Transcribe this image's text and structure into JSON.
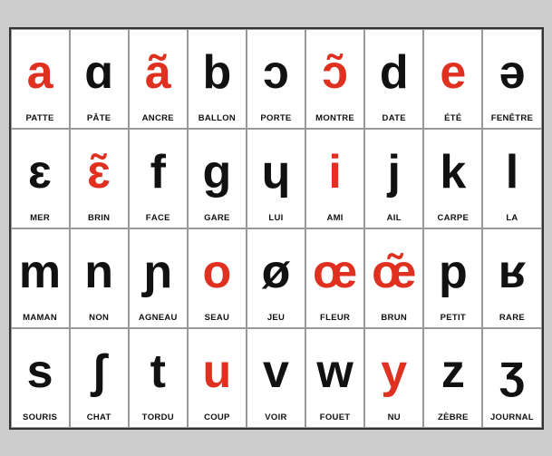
{
  "cells": [
    {
      "symbol": "a",
      "color": "red",
      "label": "PATTE",
      "boldChar": ""
    },
    {
      "symbol": "ɑ",
      "color": "black",
      "label": "PÂTE",
      "boldChar": ""
    },
    {
      "symbol": "ã",
      "color": "red",
      "label": "ANCRE",
      "boldChar": "AN"
    },
    {
      "symbol": "b",
      "color": "black",
      "label": "BALLON",
      "boldChar": "B"
    },
    {
      "symbol": "ɔ",
      "color": "black",
      "label": "PORTE",
      "boldChar": ""
    },
    {
      "symbol": "ɔ̃",
      "color": "red",
      "label": "MONTRE",
      "boldChar": "MON"
    },
    {
      "symbol": "d",
      "color": "black",
      "label": "DATE",
      "boldChar": "D"
    },
    {
      "symbol": "e",
      "color": "red",
      "label": "ÉTÉ",
      "boldChar": ""
    },
    {
      "symbol": "ə",
      "color": "black",
      "label": "FENÊTRE",
      "boldChar": ""
    },
    {
      "symbol": "ɛ",
      "color": "black",
      "label": "MER",
      "boldChar": ""
    },
    {
      "symbol": "ɛ̃",
      "color": "red",
      "label": "BRIN",
      "boldChar": "BRIN"
    },
    {
      "symbol": "f",
      "color": "black",
      "label": "FACE",
      "boldChar": "F"
    },
    {
      "symbol": "ɡ",
      "color": "black",
      "label": "GARE",
      "boldChar": "G"
    },
    {
      "symbol": "ɥ",
      "color": "black",
      "label": "LUI",
      "boldChar": ""
    },
    {
      "symbol": "i",
      "color": "red",
      "label": "AMI",
      "boldChar": ""
    },
    {
      "symbol": "j",
      "color": "black",
      "label": "AIL",
      "boldChar": ""
    },
    {
      "symbol": "k",
      "color": "black",
      "label": "CARPE",
      "boldChar": "C"
    },
    {
      "symbol": "l",
      "color": "black",
      "label": "LA",
      "boldChar": "L"
    },
    {
      "symbol": "m",
      "color": "black",
      "label": "MAMAN",
      "boldChar": "M"
    },
    {
      "symbol": "n",
      "color": "black",
      "label": "NON",
      "boldChar": "N"
    },
    {
      "symbol": "ɲ",
      "color": "black",
      "label": "AGNEAU",
      "boldChar": "GN"
    },
    {
      "symbol": "o",
      "color": "red",
      "label": "SEAU",
      "boldChar": ""
    },
    {
      "symbol": "ø",
      "color": "black",
      "label": "JEU",
      "boldChar": ""
    },
    {
      "symbol": "œ",
      "color": "red",
      "label": "FLEUR",
      "boldChar": ""
    },
    {
      "symbol": "œ̃",
      "color": "red",
      "label": "BRUN",
      "boldChar": "BRUN"
    },
    {
      "symbol": "p",
      "color": "black",
      "label": "PETIT",
      "boldChar": "P"
    },
    {
      "symbol": "ʁ",
      "color": "black",
      "label": "RARE",
      "boldChar": "R"
    },
    {
      "symbol": "s",
      "color": "black",
      "label": "SOURIS",
      "boldChar": "S"
    },
    {
      "symbol": "ʃ",
      "color": "black",
      "label": "CHAT",
      "boldChar": "CH"
    },
    {
      "symbol": "t",
      "color": "black",
      "label": "TORDU",
      "boldChar": "T"
    },
    {
      "symbol": "u",
      "color": "red",
      "label": "COUP",
      "boldChar": ""
    },
    {
      "symbol": "v",
      "color": "black",
      "label": "VOIR",
      "boldChar": "V"
    },
    {
      "symbol": "w",
      "color": "black",
      "label": "FOUET",
      "boldChar": ""
    },
    {
      "symbol": "y",
      "color": "red",
      "label": "NU",
      "boldChar": ""
    },
    {
      "symbol": "z",
      "color": "black",
      "label": "ZÈBRE",
      "boldChar": "Z"
    },
    {
      "symbol": "ʒ",
      "color": "black",
      "label": "JOURNAL",
      "boldChar": "J"
    }
  ]
}
